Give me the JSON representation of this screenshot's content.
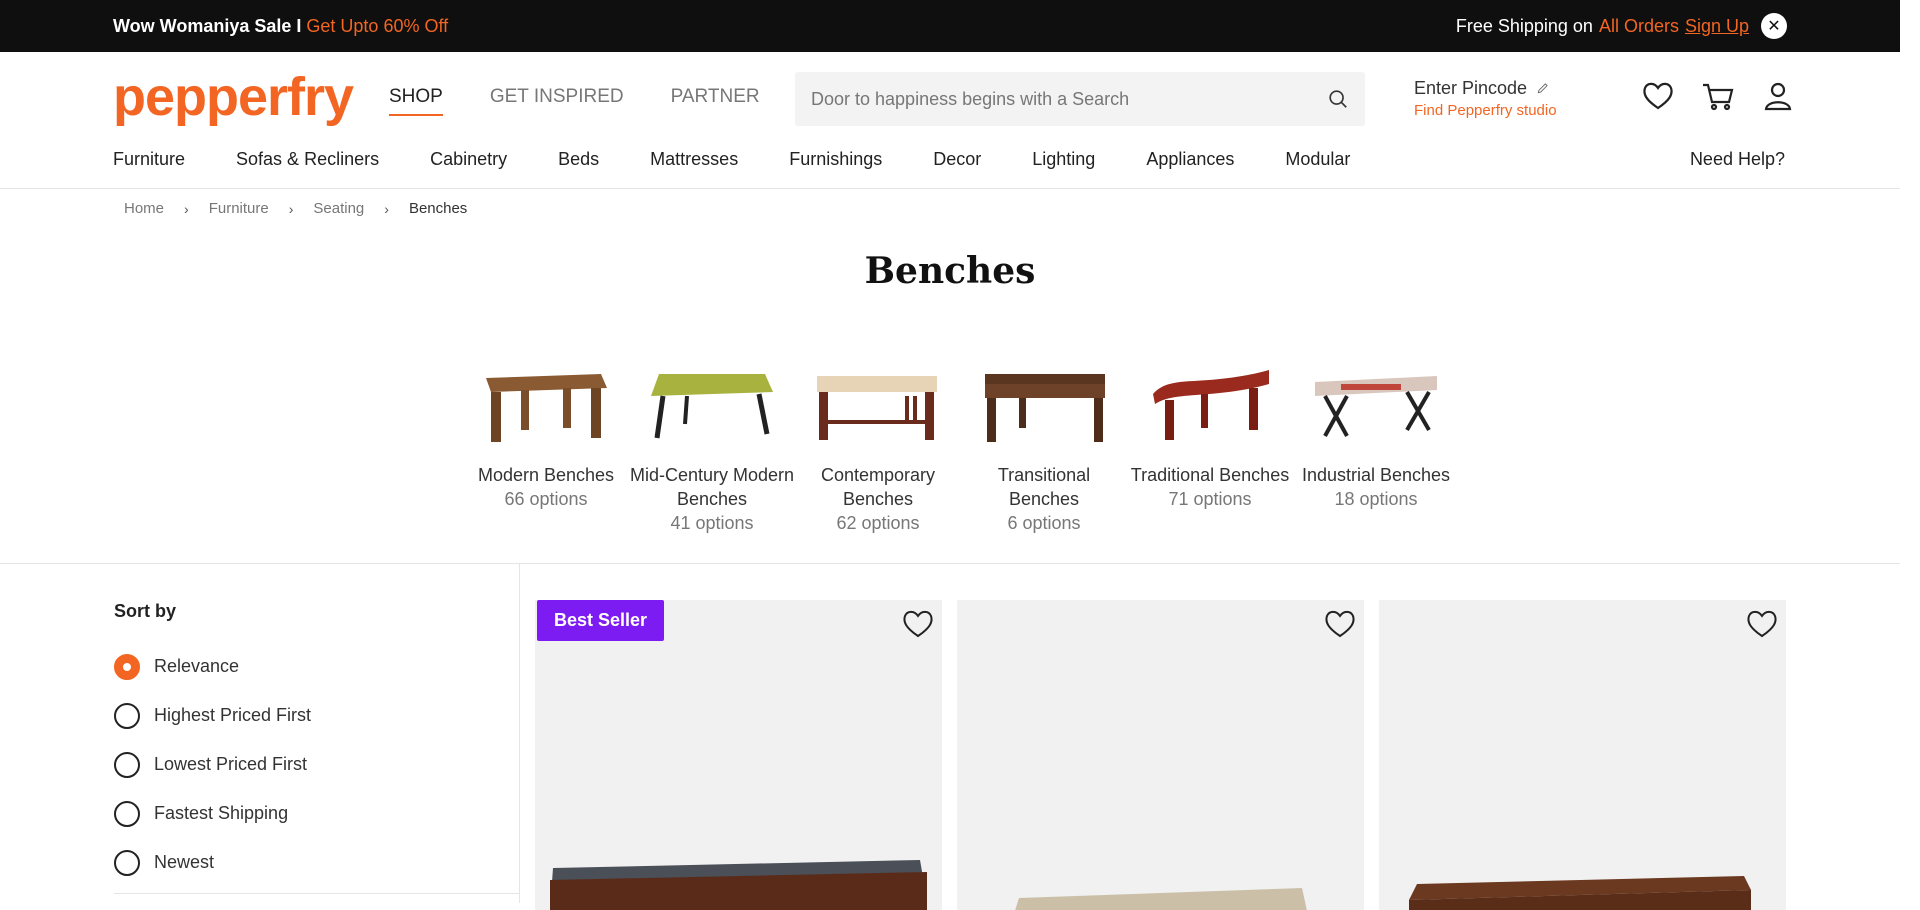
{
  "promo": {
    "sale_label": "Wow Womaniya Sale I",
    "sale_offer": "Get Upto 60% Off",
    "shipping_label": "Free Shipping on",
    "shipping_scope": "All Orders",
    "signup_link": "Sign Up",
    "close_glyph": "✕"
  },
  "header": {
    "logo": "pepperfry",
    "tabs": [
      "SHOP",
      "GET INSPIRED",
      "PARTNER"
    ],
    "active_tab": "SHOP",
    "search_placeholder": "Door to happiness begins with a Search",
    "pincode_label": "Enter Pincode",
    "studio_link": "Find Pepperfry studio",
    "icons": [
      "wishlist-icon",
      "cart-icon",
      "account-icon"
    ]
  },
  "catnav": {
    "items": [
      "Furniture",
      "Sofas & Recliners",
      "Cabinetry",
      "Beds",
      "Mattresses",
      "Furnishings",
      "Decor",
      "Lighting",
      "Appliances",
      "Modular"
    ],
    "help": "Need Help?"
  },
  "breadcrumb": [
    "Home",
    "Furniture",
    "Seating",
    "Benches"
  ],
  "page_title": "Benches",
  "subcategories": [
    {
      "name": "Modern Benches",
      "options": "66 options"
    },
    {
      "name": "Mid-Century Modern Benches",
      "options": "41 options"
    },
    {
      "name": "Contemporary Benches",
      "options": "62 options"
    },
    {
      "name": "Transitional Benches",
      "options": "6 options"
    },
    {
      "name": "Traditional Benches",
      "options": "71 options"
    },
    {
      "name": "Industrial Benches",
      "options": "18 options"
    }
  ],
  "sort": {
    "title": "Sort by",
    "options": [
      "Relevance",
      "Highest Priced First",
      "Lowest Priced First",
      "Fastest Shipping",
      "Newest"
    ],
    "selected": "Relevance"
  },
  "products": [
    {
      "badge": "Best Seller"
    },
    {
      "badge": ""
    },
    {
      "badge": ""
    }
  ],
  "colors": {
    "accent": "#f26522",
    "badge": "#7d1cf2",
    "promo_bg": "#0f0f0f"
  }
}
